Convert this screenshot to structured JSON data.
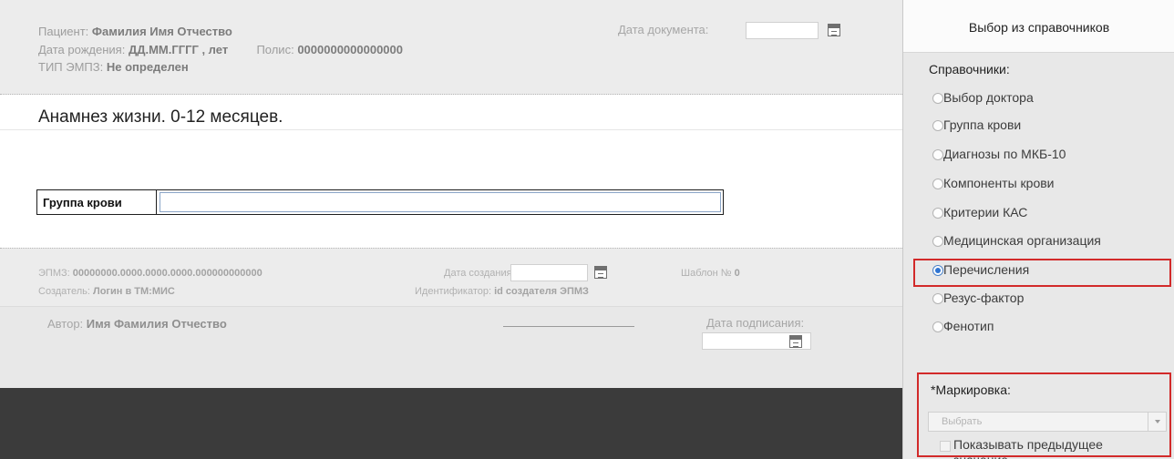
{
  "header": {
    "patient_label": "Пациент:",
    "patient_value": "Фамилия Имя Отчество",
    "dob_label": "Дата рождения:",
    "dob_value": "ДД.ММ.ГГГГ , лет",
    "policy_label": "Полис:",
    "policy_value": "0000000000000000",
    "type_label": "ТИП ЭМПЗ:",
    "type_value": "Не определен",
    "docdate_label": "Дата документа:"
  },
  "document": {
    "title": "Анамнез жизни. 0-12 месяцев.",
    "field_label": "Группа крови",
    "field_value": ""
  },
  "footer": {
    "emz_label": "ЭПМЗ:",
    "emz_value": "00000000.0000.0000.0000.000000000000",
    "creator_label": "Создатель:",
    "creator_value": "Логин в ТМ:МИС",
    "created_label": "Дата создания:",
    "ident_label": "Идентификатор:",
    "ident_value": "id создателя ЭПМЗ",
    "template_label": "Шаблон №",
    "template_value": "0",
    "author_label": "Автор:",
    "author_value": "Имя Фамилия Отчество",
    "signdate_label": "Дата подписания:"
  },
  "panel": {
    "title": "Выбор из справочников",
    "section_label": "Справочники:",
    "items": [
      {
        "label": "Выбор доктора",
        "checked": false
      },
      {
        "label": "Группа крови",
        "checked": false
      },
      {
        "label": "Диагнозы по МКБ-10",
        "checked": false
      },
      {
        "label": "Компоненты крови",
        "checked": false
      },
      {
        "label": "Критерии КАС",
        "checked": false
      },
      {
        "label": "Медицинская организация",
        "checked": false
      },
      {
        "label": "Перечисления",
        "checked": true
      },
      {
        "label": "Резус-фактор",
        "checked": false
      },
      {
        "label": "Фенотип",
        "checked": false
      }
    ],
    "marking_label": "*Маркировка:",
    "select_placeholder": "Выбрать",
    "show_prev_label": "Показывать предыдущее значение",
    "highlight_color": "#d22a2a",
    "radio_accent": "#2e74d2"
  }
}
